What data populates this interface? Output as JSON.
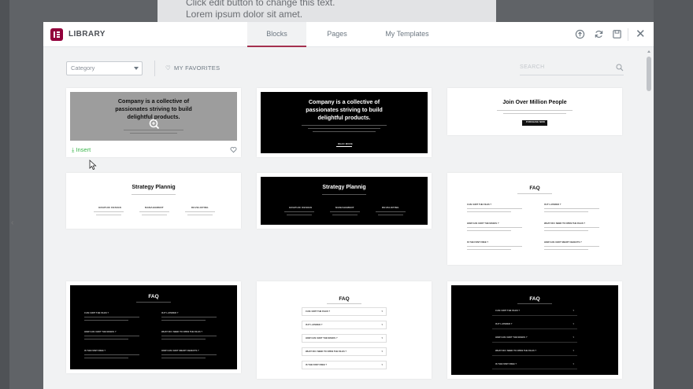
{
  "background": {
    "editor_text_1": "Click edit button to change this text.",
    "editor_text_2": "Lorem ipsum dolor sit amet."
  },
  "header": {
    "title": "LIBRARY",
    "tabs": [
      {
        "label": "Blocks",
        "active": true
      },
      {
        "label": "Pages",
        "active": false
      },
      {
        "label": "My Templates",
        "active": false
      }
    ],
    "icons": [
      "upload-icon",
      "sync-icon",
      "save-icon",
      "close-icon"
    ],
    "close_glyph": "✕"
  },
  "toolbar": {
    "category_placeholder": "Category",
    "favorites_label": "MY FAVORITES",
    "heart_glyph": "♡",
    "search_placeholder": "SEARCH"
  },
  "cards": {
    "c1": {
      "title_1": "Company is a collective of",
      "title_2": "passionates striving to build",
      "title_3": "delightful products.",
      "insert": "Insert"
    },
    "c2": {
      "title_1": "Company is a collective of",
      "title_2": "passionates striving to build",
      "title_3": "delightful products.",
      "btn": "READ MORE"
    },
    "c3": {
      "title": "Join Over Million People",
      "btn": "PURCHASE NOW"
    },
    "c4": {
      "title": "Strategy Plannig",
      "col1": "GRAPHIC DESIGN",
      "col2": "MANAGEMENT",
      "col3": "DEVELOPING"
    },
    "c5": {
      "title": "Strategy Plannig",
      "col1": "GRAPHIC DESIGN",
      "col2": "MANAGEMENT",
      "col3": "DEVELOPING"
    },
    "c6": {
      "title": "FAQ",
      "q1": "CAN I EDIT THE FILES ?",
      "q2": "IS IT LAYERED ?",
      "q3": "HOW CAN I EDIT THE MASKS ?",
      "q4": "WHAT DO I NEED TO OPEN THE FILES ?",
      "q5": "IS THE FONT FREE ?",
      "q6": "HOW CAN I EDIT SMART OBJECTS ?"
    },
    "c7": {
      "title": "FAQ",
      "q1": "CAN I EDIT THE FILES ?",
      "q2": "IS IT LAYERED ?",
      "q3": "HOW CAN I EDIT THE MASKS ?",
      "q4": "WHAT DO I NEED TO OPEN THE FILES ?",
      "q5": "IS THE FONT FREE ?",
      "q6": "HOW CAN I EDIT SMART OBJECTS ?"
    },
    "c8": {
      "title": "FAQ",
      "a1": "CAN I EDIT THE FILES ?",
      "a2": "IS IT LAYERED ?",
      "a3": "HOW CAN I EDIT THE MASKS ?",
      "a4": "WHAT DO I NEED TO OPEN THE FILES ?",
      "a5": "IS THE FONT FREE ?"
    },
    "c9": {
      "title": "FAQ",
      "a1": "CAN I EDIT THE FILES ?",
      "a2": "IS IT LAYERED ?",
      "a3": "HOW CAN I EDIT THE MASKS ?",
      "a4": "WHAT DO I NEED TO OPEN THE FILES ?",
      "a5": "IS THE FONT FREE ?"
    }
  },
  "colors": {
    "accent": "#a4304e",
    "logo": "#92003b",
    "insert": "#39b54a"
  }
}
